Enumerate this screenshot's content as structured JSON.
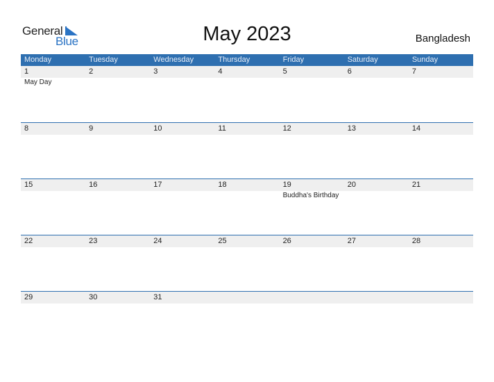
{
  "logo": {
    "general": "General",
    "blue": "Blue",
    "icon": "triangle-flag-icon"
  },
  "title": "May 2023",
  "country": "Bangladesh",
  "colors": {
    "header_bg": "#2e6fb0",
    "accent": "#2a73c4",
    "day_strip": "#efefef"
  },
  "weekdays": [
    "Monday",
    "Tuesday",
    "Wednesday",
    "Thursday",
    "Friday",
    "Saturday",
    "Sunday"
  ],
  "weeks": [
    {
      "days": [
        "1",
        "2",
        "3",
        "4",
        "5",
        "6",
        "7"
      ],
      "events": [
        "May Day",
        "",
        "",
        "",
        "",
        "",
        ""
      ]
    },
    {
      "days": [
        "8",
        "9",
        "10",
        "11",
        "12",
        "13",
        "14"
      ],
      "events": [
        "",
        "",
        "",
        "",
        "",
        "",
        ""
      ]
    },
    {
      "days": [
        "15",
        "16",
        "17",
        "18",
        "19",
        "20",
        "21"
      ],
      "events": [
        "",
        "",
        "",
        "",
        "Buddha's Birthday",
        "",
        ""
      ]
    },
    {
      "days": [
        "22",
        "23",
        "24",
        "25",
        "26",
        "27",
        "28"
      ],
      "events": [
        "",
        "",
        "",
        "",
        "",
        "",
        ""
      ]
    },
    {
      "days": [
        "29",
        "30",
        "31",
        "",
        "",
        "",
        ""
      ],
      "events": [
        "",
        "",
        "",
        "",
        "",
        "",
        ""
      ]
    }
  ]
}
